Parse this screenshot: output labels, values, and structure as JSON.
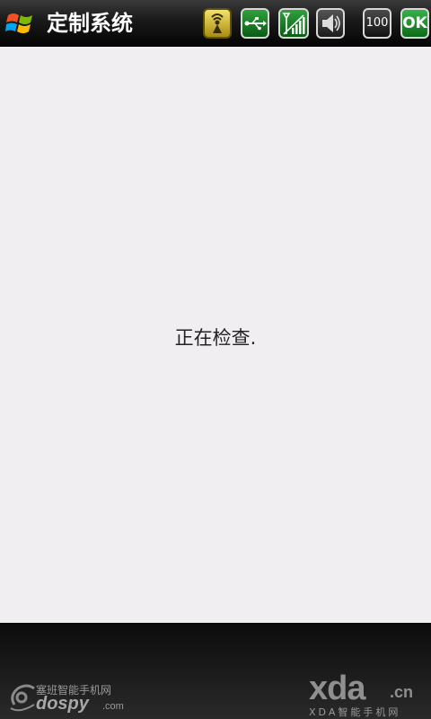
{
  "title_bar": {
    "app_title": "定制系统",
    "start_icon": "windows-flag-icon",
    "tray": {
      "wifi_icon": "wifi-antenna-icon",
      "usb_icon": "usb-icon",
      "signal_icon": "signal-strength-icon",
      "volume_icon": "speaker-icon",
      "battery_label": "100",
      "ok_label": "OK"
    }
  },
  "content": {
    "status_text": "正在检查."
  },
  "watermarks": {
    "dospy_cn": "塞班智能手机网",
    "dospy_brand": "dospy",
    "dospy_suffix": ".com",
    "xda_brand": "xda",
    "xda_domain": ".cn",
    "xda_subtitle": "XDA智能手机网"
  },
  "colors": {
    "content_background": "#f1eef1",
    "ok_green": "#1e8a2c",
    "wifi_yellow": "#d8c035"
  }
}
